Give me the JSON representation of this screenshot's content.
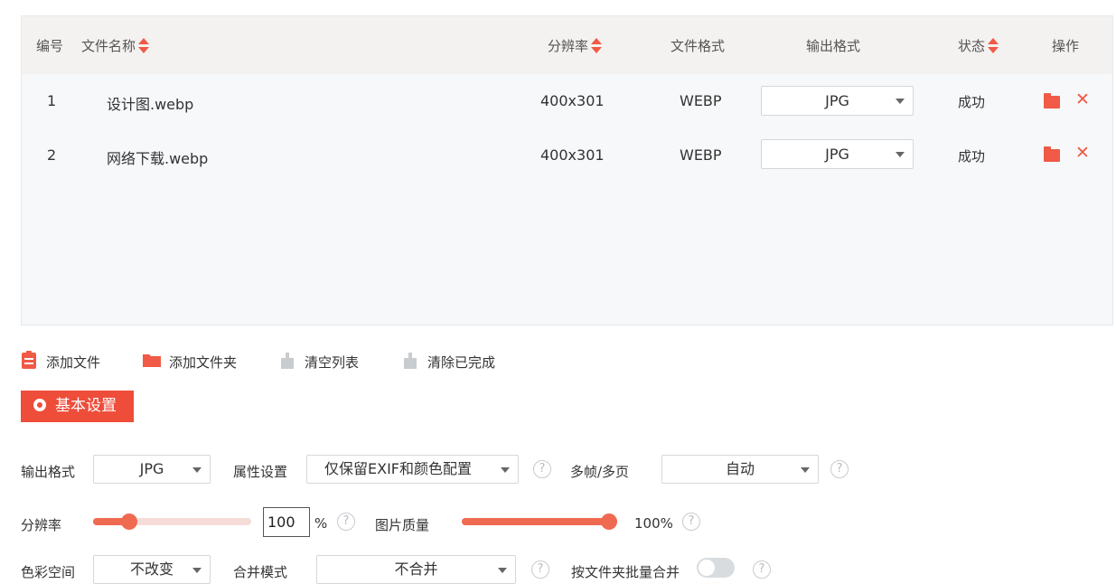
{
  "table": {
    "headers": {
      "index": "编号",
      "filename": "文件名称",
      "resolution": "分辨率",
      "format": "文件格式",
      "output_format": "输出格式",
      "status": "状态",
      "actions": "操作"
    },
    "rows": [
      {
        "index": "1",
        "filename": "设计图.webp",
        "resolution": "400x301",
        "format": "WEBP",
        "output_format": "JPG",
        "status": "成功"
      },
      {
        "index": "2",
        "filename": "网络下载.webp",
        "resolution": "400x301",
        "format": "WEBP",
        "output_format": "JPG",
        "status": "成功"
      }
    ]
  },
  "toolbar": {
    "add_file": "添加文件",
    "add_folder": "添加文件夹",
    "clear_list": "清空列表",
    "clear_done": "清除已完成"
  },
  "settings": {
    "tab_label": "基本设置",
    "output_format_label": "输出格式",
    "output_format_value": "JPG",
    "attribute_label": "属性设置",
    "attribute_value": "仅保留EXIF和颜色配置",
    "multiframe_label": "多帧/多页",
    "multiframe_value": "自动",
    "resolution_label": "分辨率",
    "resolution_value": "100",
    "resolution_unit": "%",
    "resolution_slider_fraction": 0.23,
    "quality_label": "图片质量",
    "quality_value": "100%",
    "quality_slider_fraction": 1.0,
    "colorspace_label": "色彩空间",
    "colorspace_value": "不改变",
    "merge_label": "合并模式",
    "merge_value": "不合并",
    "batch_merge_label": "按文件夹批量合并",
    "batch_merge_enabled": false,
    "help_symbol": "?"
  },
  "colors": {
    "accent": "#ee4d3a",
    "header_bg": "#f4f2f0",
    "panel_bg": "#f6f8fa"
  },
  "icons": [
    "sort-icon",
    "folder-icon",
    "close-icon",
    "add-file-icon",
    "add-folder-icon",
    "clear-list-icon",
    "clear-done-icon",
    "gear-icon",
    "help-icon",
    "chevron-down-icon"
  ]
}
